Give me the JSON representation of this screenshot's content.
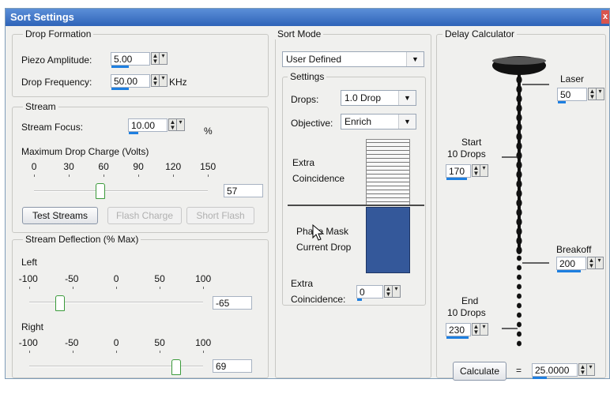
{
  "window": {
    "title": "Sort Settings",
    "close_glyph": "x"
  },
  "drop_formation": {
    "legend": "Drop Formation",
    "piezo_label": "Piezo Amplitude:",
    "piezo_value": "5.00",
    "freq_label": "Drop Frequency:",
    "freq_value": "50.00",
    "freq_unit": "KHz"
  },
  "stream": {
    "legend": "Stream",
    "focus_label": "Stream Focus:",
    "focus_value": "10.00",
    "focus_unit": "%",
    "charge_label": "Maximum Drop Charge (Volts)",
    "charge_ticks": [
      "0",
      "30",
      "60",
      "90",
      "120",
      "150"
    ],
    "charge_value": "57",
    "charge_level": 57,
    "test_button": "Test Streams",
    "flash_button": "Flash Charge",
    "short_button": "Short Flash"
  },
  "deflection": {
    "legend": "Stream Deflection (% Max)",
    "left_label": "Left",
    "right_label": "Right",
    "ticks": [
      "-100",
      "-50",
      "0",
      "50",
      "100"
    ],
    "left_value": "-65",
    "left_level": -65,
    "right_value": "69",
    "right_level": 69
  },
  "sort_mode": {
    "legend": "Sort Mode",
    "mode_value": "User Defined",
    "settings_legend": "Settings",
    "drops_label": "Drops:",
    "drops_value": "1.0 Drop",
    "objective_label": "Objective:",
    "objective_value": "Enrich",
    "extra_coinc_top": [
      "Extra",
      "Coincidence"
    ],
    "phase_mask": "Phase Mask",
    "current_drop": "Current Drop",
    "extra_coinc_bottom": [
      "Extra",
      "Coincidence:"
    ],
    "extra_coinc_value": "0"
  },
  "delay_calculator": {
    "legend": "Delay Calculator",
    "laser_label": "Laser",
    "laser_value": "50",
    "start_label": [
      "Start",
      "10 Drops"
    ],
    "start_value": "170",
    "breakoff_label": "Breakoff",
    "breakoff_value": "200",
    "end_label": [
      "End",
      "10 Drops"
    ],
    "end_value": "230",
    "calculate_button": "Calculate",
    "equals": "=",
    "result_value": "25.0000"
  },
  "colors": {
    "accent_underline": "#1e7fe0",
    "phase_mask_fill": "#34589a",
    "titlebar": "#2e63b8"
  }
}
